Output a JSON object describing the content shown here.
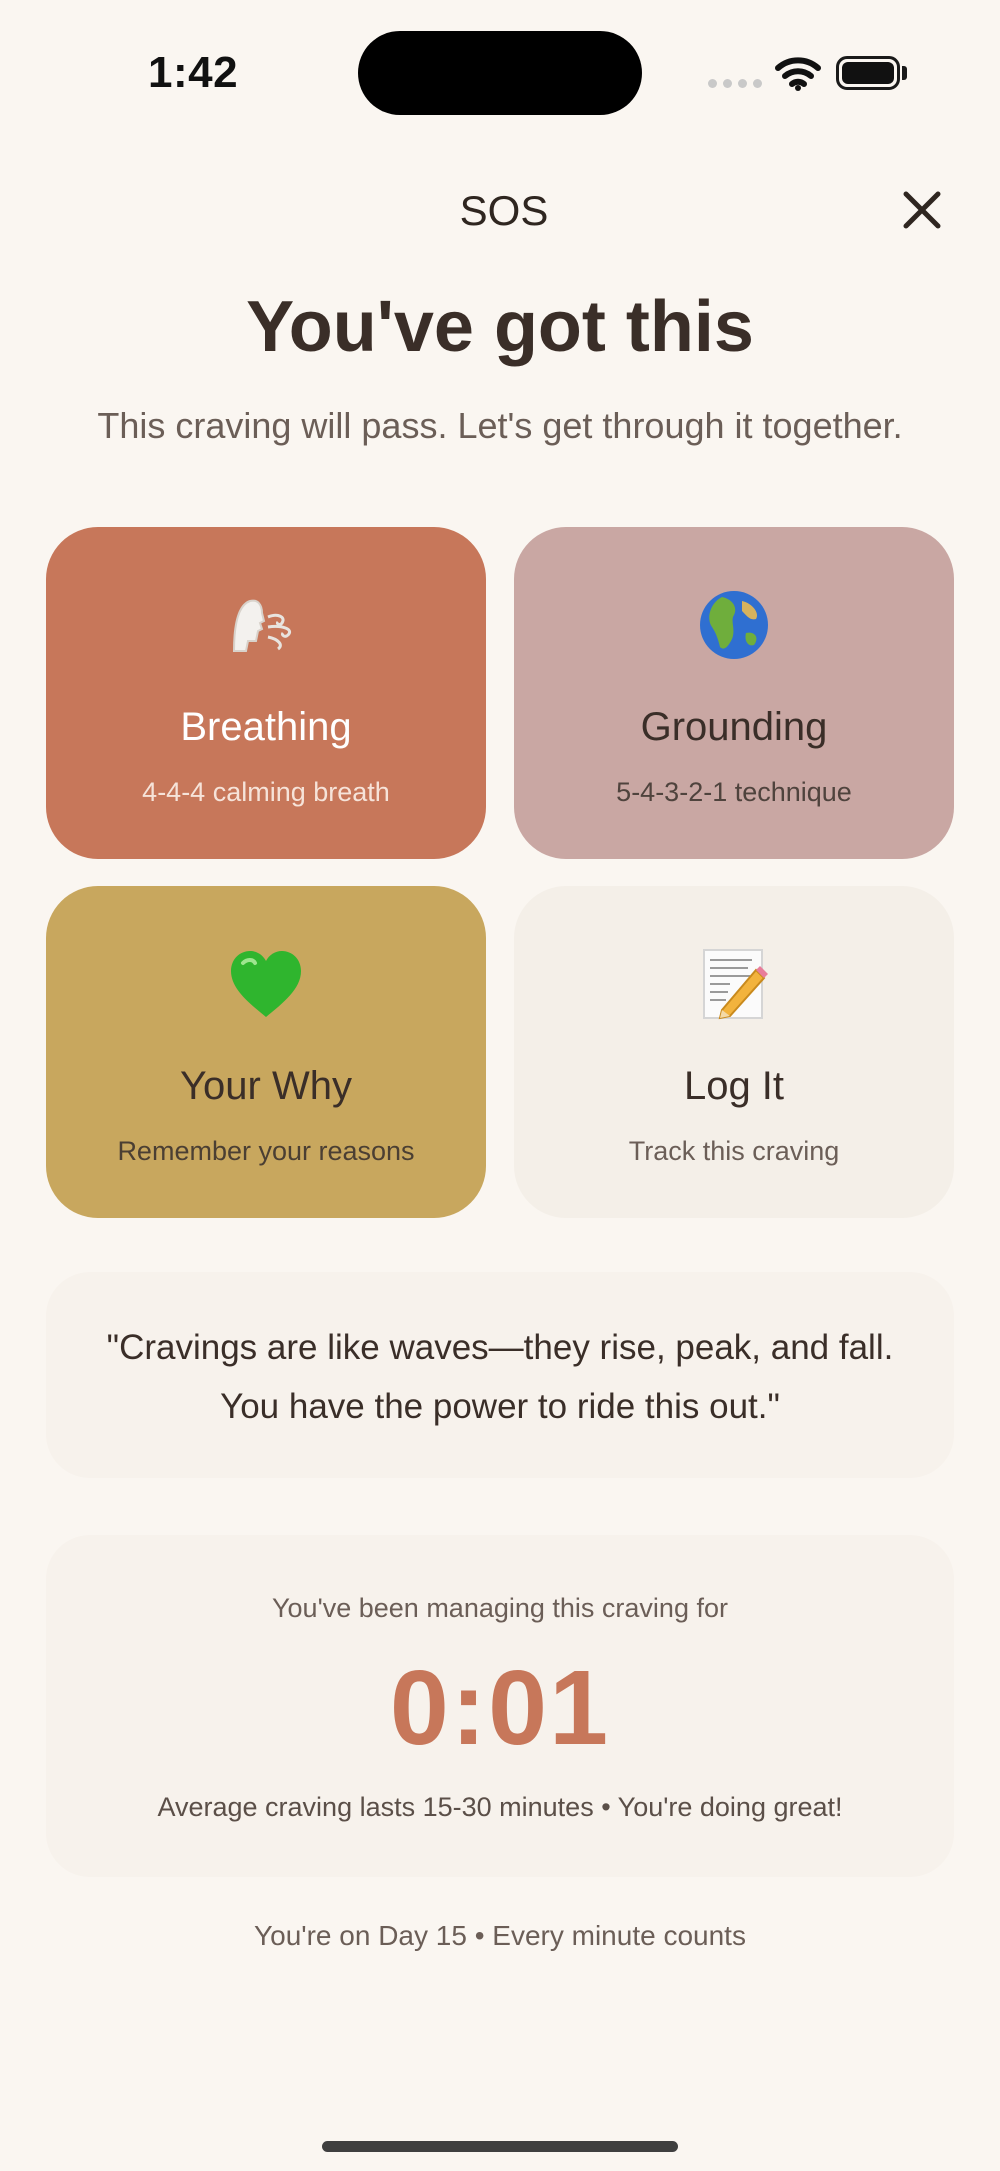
{
  "status_bar": {
    "time": "1:42"
  },
  "header": {
    "title": "SOS"
  },
  "hero": {
    "headline": "You've got this",
    "subheadline": "This craving will pass. Let's get through it together."
  },
  "cards": [
    {
      "icon": "breathing-face-icon",
      "title": "Breathing",
      "subtitle": "4-4-4 calming breath",
      "color": "#c7775a"
    },
    {
      "icon": "globe-icon",
      "title": "Grounding",
      "subtitle": "5-4-3-2-1 technique",
      "color": "#c9a7a3"
    },
    {
      "icon": "green-heart-icon",
      "title": "Your Why",
      "subtitle": "Remember your reasons",
      "color": "#c8a75e"
    },
    {
      "icon": "memo-pencil-icon",
      "title": "Log It",
      "subtitle": "Track this craving",
      "color": "#f4efe8"
    }
  ],
  "quote": {
    "text": "\"Cravings are like waves—they rise, peak, and fall. You have the power to ride this out.\""
  },
  "timer": {
    "label": "You've been managing this craving for",
    "value": "0:01",
    "note": "Average craving lasts 15-30 minutes • You're doing great!"
  },
  "footer": {
    "text": "You're on Day 15 • Every minute counts"
  },
  "theme": {
    "accent": "#c7775a",
    "background": "#faf6f1"
  }
}
